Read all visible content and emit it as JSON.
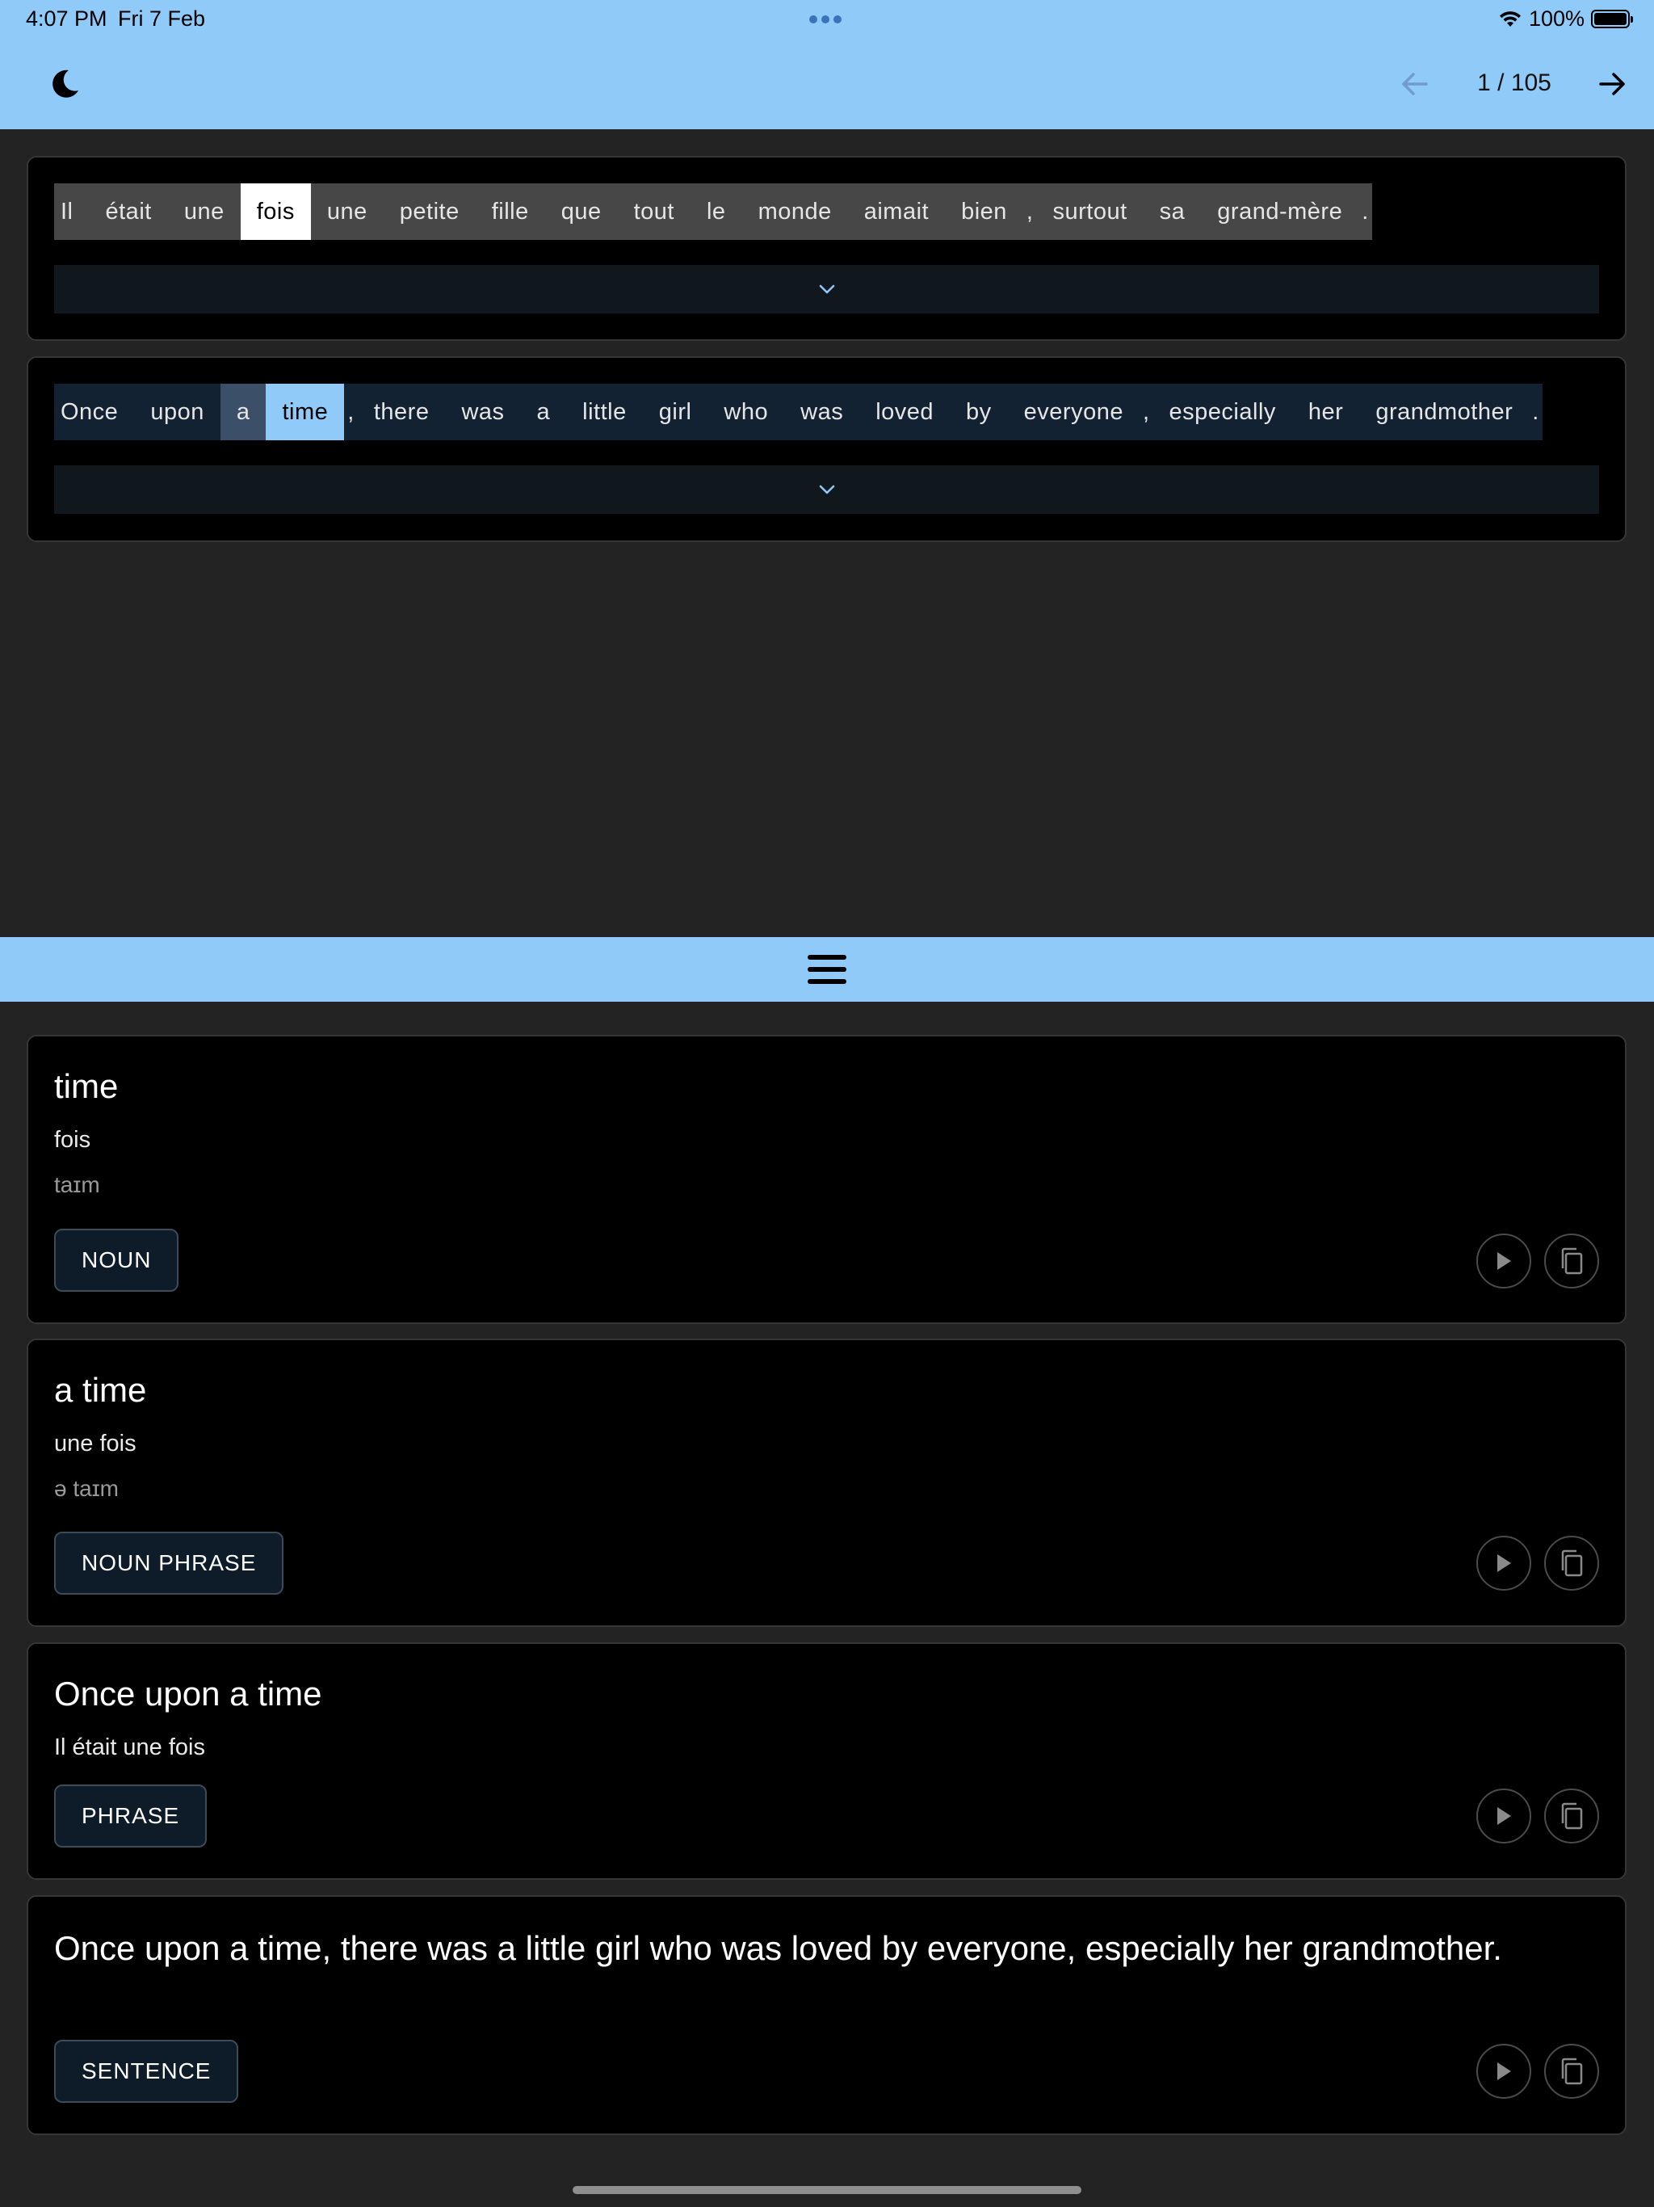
{
  "status_bar": {
    "time": "4:07 PM",
    "date": "Fri 7 Feb",
    "battery": "100%",
    "battery_level": 1.0
  },
  "header": {
    "theme_icon": "moon-icon",
    "page_indicator": "1 / 105",
    "prev_icon": "arrow-left-icon",
    "next_icon": "arrow-right-icon",
    "accent_color": "#90caf9"
  },
  "source_sentence": {
    "tokens": [
      "Il",
      "était",
      "une",
      "fois",
      "une",
      "petite",
      "fille",
      "que",
      "tout",
      "le",
      "monde",
      "aimait",
      "bien",
      ",",
      "surtout",
      "sa",
      "grand-mère",
      "."
    ],
    "selected": "fois"
  },
  "target_sentence": {
    "tokens": [
      "Once",
      "upon",
      "a",
      "time",
      ",",
      "there",
      "was",
      "a",
      "little",
      "girl",
      "who",
      "was",
      "loved",
      "by",
      "everyone",
      ",",
      "especially",
      "her",
      "grandmother",
      "."
    ],
    "selected": "time"
  },
  "entries": [
    {
      "title": "time",
      "translation": "fois",
      "ipa": "taɪm",
      "tag": "NOUN"
    },
    {
      "title": "a time",
      "translation": "une fois",
      "ipa": "ə taɪm",
      "tag": "NOUN PHRASE"
    },
    {
      "title": "Once upon a time",
      "translation": "Il était une fois",
      "tag": "PHRASE"
    },
    {
      "title": "Once upon a time, there was a little girl who was loved by everyone, especially her grandmother.",
      "tag": "SENTENCE"
    }
  ]
}
